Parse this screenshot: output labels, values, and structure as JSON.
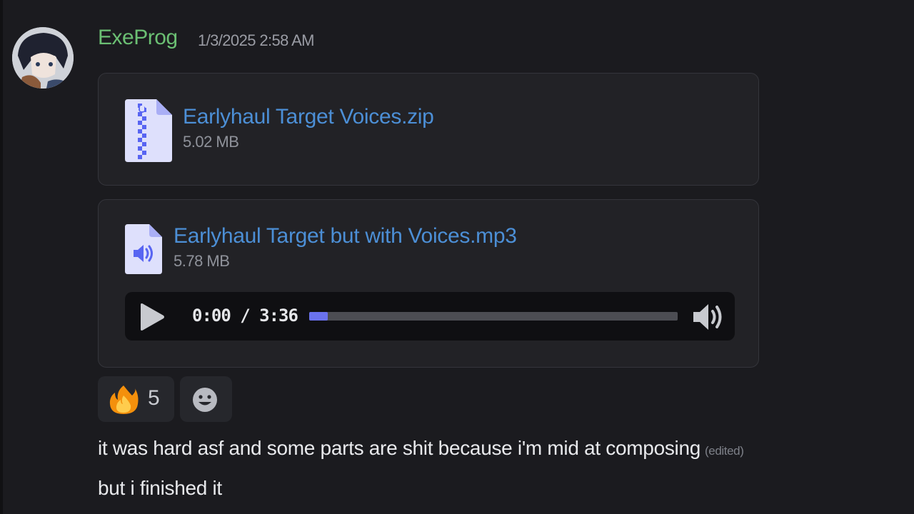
{
  "message": {
    "author": "ExeProg",
    "timestamp": "1/3/2025 2:58 AM",
    "author_color": "#6bbf73"
  },
  "attachments": [
    {
      "icon": "zip-file-icon",
      "name": "Earlyhaul Target Voices.zip",
      "size": "5.02 MB"
    },
    {
      "icon": "audio-file-icon",
      "name": "Earlyhaul Target but with Voices.mp3",
      "size": "5.78 MB",
      "player": {
        "time": "0:00 / 3:36",
        "progress_fraction": 0.05
      }
    }
  ],
  "reactions": [
    {
      "emoji": "fire",
      "count": "5"
    },
    {
      "emoji": "add-reaction-smiley"
    }
  ],
  "body": {
    "line1": "it was hard asf and some parts are shit because i'm mid at composing",
    "edited_label": "(edited)",
    "line2": "but i finished it"
  },
  "colors": {
    "link": "#4c8fd6",
    "accent": "#6a72ee",
    "background": "#1b1b1f"
  }
}
